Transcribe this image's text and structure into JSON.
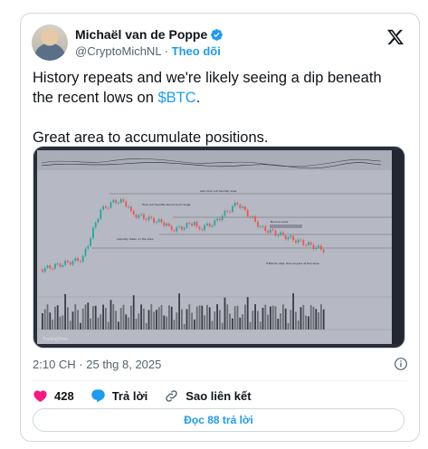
{
  "author": {
    "name": "Michaël van de Poppe",
    "handle": "@CryptoMichNL",
    "separator": "·",
    "follow_label": "Theo dõi"
  },
  "post": {
    "text_line1_prefix": "History repeats and we're likely seeing a dip beneath the recent lows on ",
    "cashtag": "$BTC",
    "text_line1_suffix": ".",
    "text_line2": "Great area to accumulate positions."
  },
  "chart_image": {
    "watermark": "TradingView",
    "annotations": [
      "Also took out liquidity lows",
      "Took out liquidity above local range",
      "Liquidity taken on the lows",
      "Bounce level",
      "If Bitcoin dips, then buyers at this level"
    ],
    "colors": {
      "up": "#26a69a",
      "down": "#ef5350",
      "background": "#b6b9c3"
    }
  },
  "meta": {
    "timestamp": "2:10 CH · 25 thg 8, 2025"
  },
  "actions": {
    "like_count": "428",
    "reply_label": "Trả lời",
    "copy_link_label": "Sao liên kết"
  },
  "replies_button": {
    "label": "Đọc 88 trả lời"
  },
  "icons": {
    "verified": "verified-badge-icon",
    "x_logo": "x-logo-icon",
    "info": "info-icon",
    "heart": "heart-icon",
    "reply": "reply-icon",
    "link": "link-icon"
  },
  "colors": {
    "accent": "#1d9bf0",
    "like": "#f91880",
    "muted": "#536471",
    "border": "#cfd9de"
  }
}
